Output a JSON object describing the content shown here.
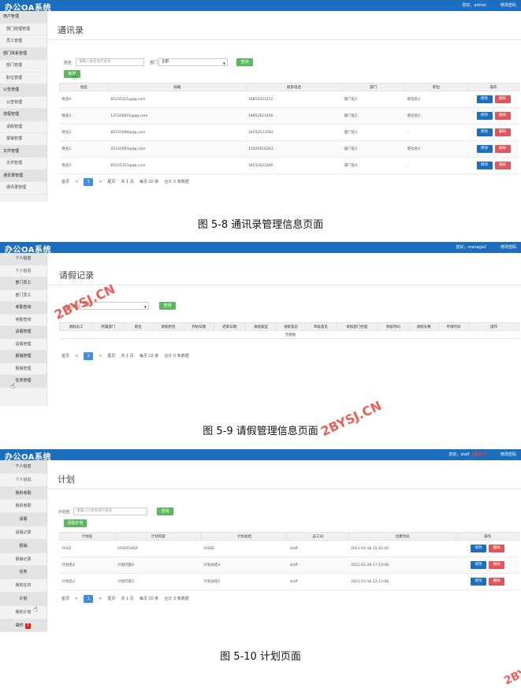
{
  "app": {
    "brand": "办公OA系统",
    "change_password": "修改密码"
  },
  "shot1": {
    "user_label": "您好，admin",
    "sidebar": [
      {
        "label": "用户管理",
        "group": true
      },
      {
        "label": "部门经理管理",
        "group": false
      },
      {
        "label": "员工管理",
        "group": false
      },
      {
        "label": "部门体系管理",
        "group": true
      },
      {
        "label": "部门管理",
        "group": false
      },
      {
        "label": "职位管理",
        "group": false
      },
      {
        "label": "公告管理",
        "group": true
      },
      {
        "label": "公告管理",
        "group": false
      },
      {
        "label": "流程管理",
        "group": true
      },
      {
        "label": "请假管理",
        "group": false
      },
      {
        "label": "报销管理",
        "group": false
      },
      {
        "label": "文件管理",
        "group": true
      },
      {
        "label": "文件管理",
        "group": false
      },
      {
        "label": "通讯录管理",
        "group": true
      },
      {
        "label": "通讯录管理",
        "group": false
      }
    ],
    "title": "通讯录",
    "search": {
      "name_label": "姓名",
      "name_placeholder": "请输入姓名进行查询",
      "dept_label": "部门",
      "dept_value": "全部",
      "query_button": "查询",
      "add_button": "新增"
    },
    "table": {
      "headers": [
        "姓名",
        "邮箱",
        "联系电话",
        "部门",
        "职位",
        "操作"
      ],
      "rows": [
        [
          "姓名4",
          "85235211@qq.com",
          "18852623152",
          "部门名2",
          "职位名2"
        ],
        [
          "姓名3",
          "125316021@qq.com",
          "18852623160",
          "部门名2",
          "职位名2"
        ],
        [
          "姓名2",
          "85235098@qq.com",
          "18552623283",
          "部门名4",
          "-"
        ],
        [
          "姓名1",
          "25235095@qq.com",
          "15555616281",
          "部门名2",
          "职位名4"
        ],
        [
          "姓名5",
          "85235155@qq.com",
          "18552623285",
          "部门名4",
          "-"
        ]
      ],
      "edit": "修改",
      "delete": "删除"
    },
    "pager": {
      "first": "首页",
      "prev": "<",
      "page": "1",
      "next": ">",
      "last": "尾页",
      "total_pages": "共 1 页",
      "per_page": "每页 10 条",
      "total": "合计 5 条数据"
    },
    "caption": "图 5-8 通讯录管理信息页面"
  },
  "shot2": {
    "user_label": "您好，manage2",
    "sidebar": [
      {
        "label": "个人信息",
        "group": true
      },
      {
        "label": "个人信息",
        "group": false
      },
      {
        "label": "部门员工",
        "group": true
      },
      {
        "label": "部门员工",
        "group": false
      },
      {
        "label": "考勤查询",
        "group": true
      },
      {
        "label": "考勤查询",
        "group": false
      },
      {
        "label": "请假管理",
        "group": true
      },
      {
        "label": "请假管理",
        "group": false
      },
      {
        "label": "报销管理",
        "group": true
      },
      {
        "label": "报销管理",
        "group": false
      },
      {
        "label": "任务管理",
        "group": true
      }
    ],
    "title": "请假记录",
    "search": {
      "type_label": "请假类型",
      "type_value": "全部",
      "query_button": "查询"
    },
    "table": {
      "headers": [
        "请假员工",
        "所属部门",
        "职位",
        "请假原因",
        "开始日期",
        "结束日期",
        "请假类型",
        "请假状态",
        "审核意见",
        "审核部门经理",
        "审核时间",
        "请假天数",
        "申请时间",
        "操作"
      ],
      "empty": "无数据"
    },
    "pager": {
      "first": "首页",
      "prev": "<",
      "page": "1",
      "next": ">",
      "last": "尾页",
      "total_pages": "共 1 页",
      "per_page": "每页 10 条",
      "total": "合计 0 条数据"
    },
    "caption": "图 5-9 请假管理信息页面"
  },
  "shot3": {
    "user_label_prefix": "您好，staff",
    "user_label_highlight": "上班打卡",
    "sidebar": [
      {
        "label": "个人信息",
        "group": true
      },
      {
        "label": "个人信息",
        "group": false
      },
      {
        "label": "我的考勤",
        "group": true
      },
      {
        "label": "我的考勤",
        "group": false
      },
      {
        "label": "请假",
        "group": true
      },
      {
        "label": "请假记录",
        "group": false
      },
      {
        "label": "报销",
        "group": true
      },
      {
        "label": "报销记录",
        "group": false
      },
      {
        "label": "任务",
        "group": true
      },
      {
        "label": "我的任务",
        "group": false
      },
      {
        "label": "计划",
        "group": true
      },
      {
        "label": "我的计划",
        "group": false
      },
      {
        "label": "邮件",
        "group": true,
        "badge": "1"
      }
    ],
    "title": "计划",
    "search": {
      "name_label": "计划名",
      "name_placeholder": "请输入计划名进行查询",
      "query_button": "查询",
      "add_button": "添加计划"
    },
    "table": {
      "headers": [
        "计划名",
        "计划内容",
        "计划总结",
        "员工ID",
        "创建时间",
        "操作"
      ],
      "rows": [
        [
          "FASD",
          "FASDFSADF",
          "FASDF",
          "staff",
          "2021-03-18 15:41:40"
        ],
        [
          "计划名4",
          "计划内容4",
          "计划总结4",
          "staff",
          "2021-02-28 17:13:08"
        ],
        [
          "计划名2",
          "计划内容2",
          "计划总结2",
          "staff",
          "2021-03-18 22:13:08"
        ]
      ],
      "edit": "修改",
      "delete": "删除"
    },
    "pager": {
      "first": "首页",
      "prev": "<",
      "page": "1",
      "next": ">",
      "last": "尾页",
      "total_pages": "共 1 页",
      "per_page": "每页 10 条",
      "total": "合计 3 条数据"
    },
    "caption": "图 5-10 计划页面"
  },
  "watermark": "2BYSJ.CN",
  "colors": {
    "header_blue": "#1c6fbf",
    "green": "#5cb85c",
    "red": "#e0575b",
    "watermark": "#e7463c"
  }
}
